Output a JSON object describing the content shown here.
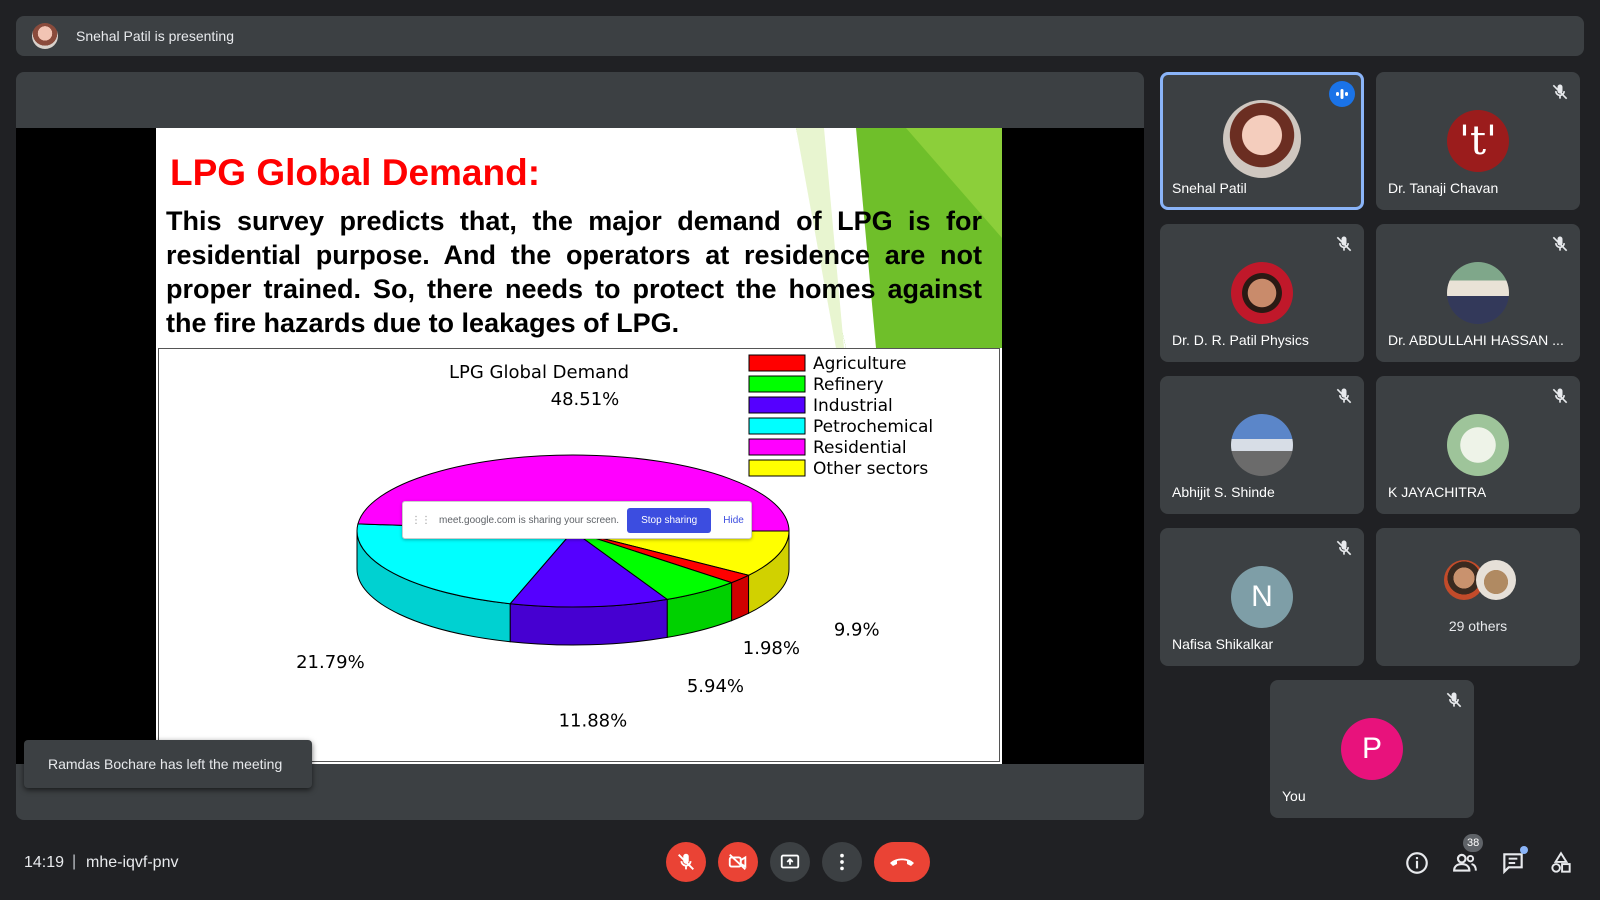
{
  "presenting": {
    "text": "Snehal Patil is presenting"
  },
  "slide": {
    "title": "LPG Global Demand:",
    "body": "This survey predicts that, the major demand of LPG is for residential purpose. And the operators at residence are not proper trained. So, there needs to protect the homes against the fire hazards due to leakages of LPG."
  },
  "chart_data": {
    "type": "pie",
    "title": "LPG Global Demand",
    "categories": [
      "Agriculture",
      "Refinery",
      "Industrial",
      "Petrochemical",
      "Residential",
      "Other sectors"
    ],
    "values": [
      1.98,
      5.94,
      11.88,
      21.79,
      48.51,
      9.9
    ],
    "value_labels": [
      "1.98%",
      "5.94%",
      "11.88%",
      "21.79%",
      "48.51%",
      "9.9%"
    ],
    "colors": [
      "#ff0000",
      "#00ff00",
      "#5500ff",
      "#00ffff",
      "#ff00ff",
      "#ffff00"
    ],
    "legend": "top-right",
    "style": "3d"
  },
  "share_notice": {
    "text": "meet.google.com is sharing your screen.",
    "stop_label": "Stop sharing",
    "hide_label": "Hide"
  },
  "toast": {
    "text": "Ramdas Bochare has left the meeting"
  },
  "participants": [
    {
      "name": "Snehal Patil",
      "speaking": true
    },
    {
      "name": "Dr. Tanaji Chavan",
      "initial": "'t'",
      "color": "#9b1c1c"
    },
    {
      "name": "Dr. D. R. Patil Physics"
    },
    {
      "name": "Dr. ABDULLAHI HASSAN ..."
    },
    {
      "name": "Abhijit S. Shinde"
    },
    {
      "name": "K JAYACHITRA"
    },
    {
      "name": "Nafisa Shikalkar",
      "initial": "N",
      "color": "#7e9ea7"
    }
  ],
  "others": {
    "label": "29 others"
  },
  "you": {
    "name": "You",
    "initial": "P",
    "color": "#e8127c"
  },
  "bottom": {
    "time": "14:19",
    "separator": "|",
    "meeting_code": "mhe-iqvf-pnv",
    "people_count": "38"
  }
}
